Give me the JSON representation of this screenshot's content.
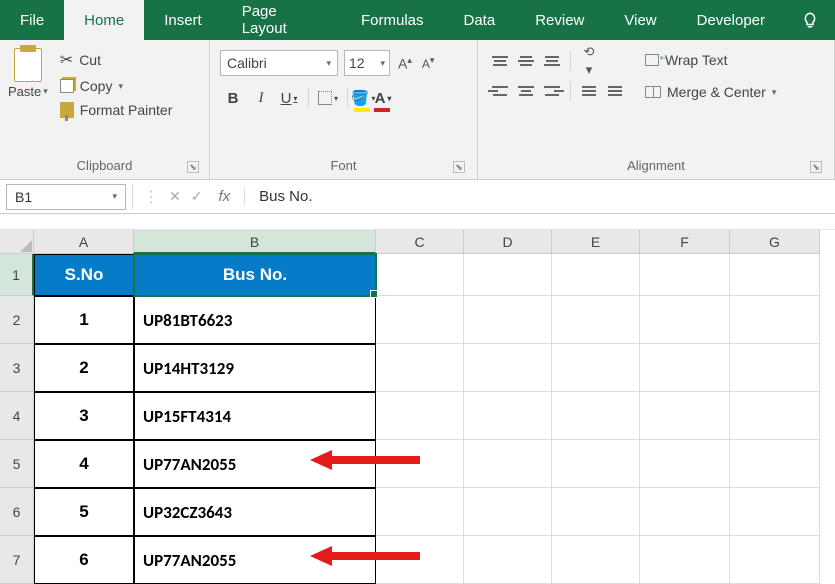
{
  "tabs": [
    "File",
    "Home",
    "Insert",
    "Page Layout",
    "Formulas",
    "Data",
    "Review",
    "View",
    "Developer"
  ],
  "active_tab": "Home",
  "clipboard": {
    "paste": "Paste",
    "cut": "Cut",
    "copy": "Copy",
    "painter": "Format Painter",
    "label": "Clipboard"
  },
  "font": {
    "name": "Calibri",
    "size": "12",
    "bold": "B",
    "italic": "I",
    "underline": "U",
    "label": "Font"
  },
  "alignment": {
    "wrap": "Wrap Text",
    "merge": "Merge & Center",
    "label": "Alignment"
  },
  "formula_bar": {
    "name_box": "B1",
    "fx": "fx",
    "value": "Bus No."
  },
  "columns": [
    "A",
    "B",
    "C",
    "D",
    "E",
    "F",
    "G"
  ],
  "headers": {
    "A": "S.No",
    "B": "Bus No."
  },
  "rows": [
    {
      "n": "1",
      "a": "1",
      "b": "UP81BT6623"
    },
    {
      "n": "2",
      "a": "2",
      "b": "UP14HT3129"
    },
    {
      "n": "3",
      "a": "3",
      "b": "UP15FT4314"
    },
    {
      "n": "4",
      "a": "4",
      "b": "UP77AN2055"
    },
    {
      "n": "5",
      "a": "5",
      "b": "UP32CZ3643"
    },
    {
      "n": "6",
      "a": "6",
      "b": "UP77AN2055"
    }
  ],
  "selected_cell": "B1",
  "selected_col": "B",
  "selected_row": "1"
}
